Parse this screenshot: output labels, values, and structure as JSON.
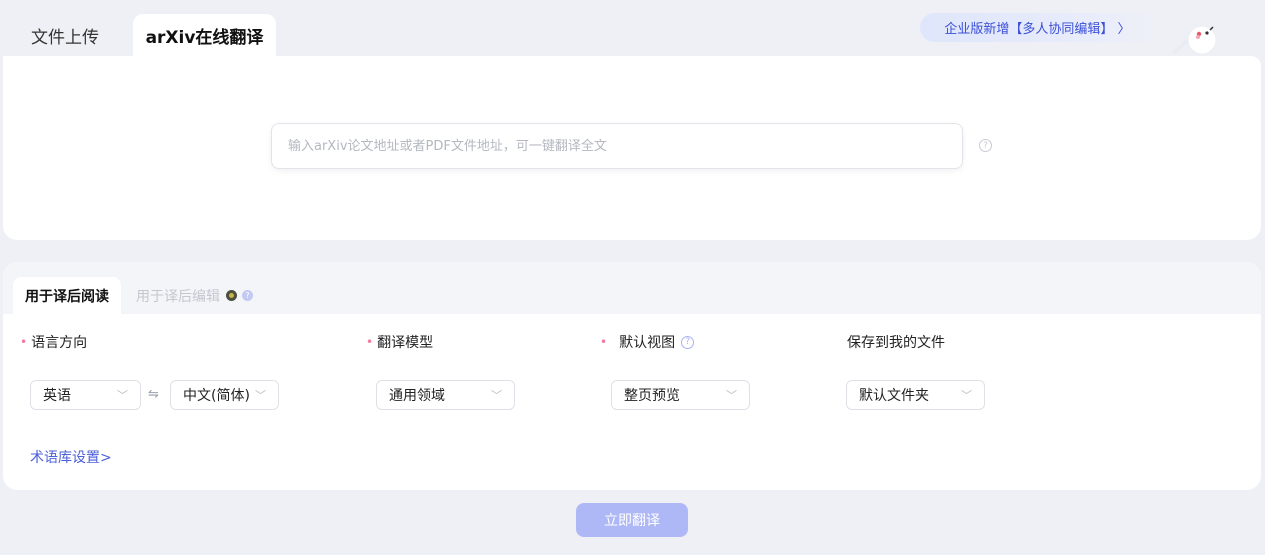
{
  "top_tabs": {
    "file_upload": "文件上传",
    "arxiv": "arXiv在线翻译"
  },
  "promo": {
    "label": "企业版新增【多人协同编辑】 〉"
  },
  "upload": {
    "placeholder": "输入arXiv论文地址或者PDF文件地址，可一键翻译全文",
    "value": ""
  },
  "settings_tabs": {
    "read": "用于译后阅读",
    "edit": "用于译后编辑"
  },
  "fields": {
    "language_direction": "语言方向",
    "model": "翻译模型",
    "default_view": "默认视图",
    "save_to": "保存到我的文件"
  },
  "selects": {
    "source_lang": "英语",
    "target_lang": "中文(简体)",
    "model": "通用领域",
    "view": "整页预览",
    "folder": "默认文件夹"
  },
  "swap_symbol": "⇋",
  "term_link": "术语库设置>",
  "translate_button": "立即翻译",
  "colors": {
    "accent": "#4a5fd8",
    "button_disabled": "#aeb8f6",
    "required": "#f07b9a",
    "background": "#eef0f6"
  }
}
